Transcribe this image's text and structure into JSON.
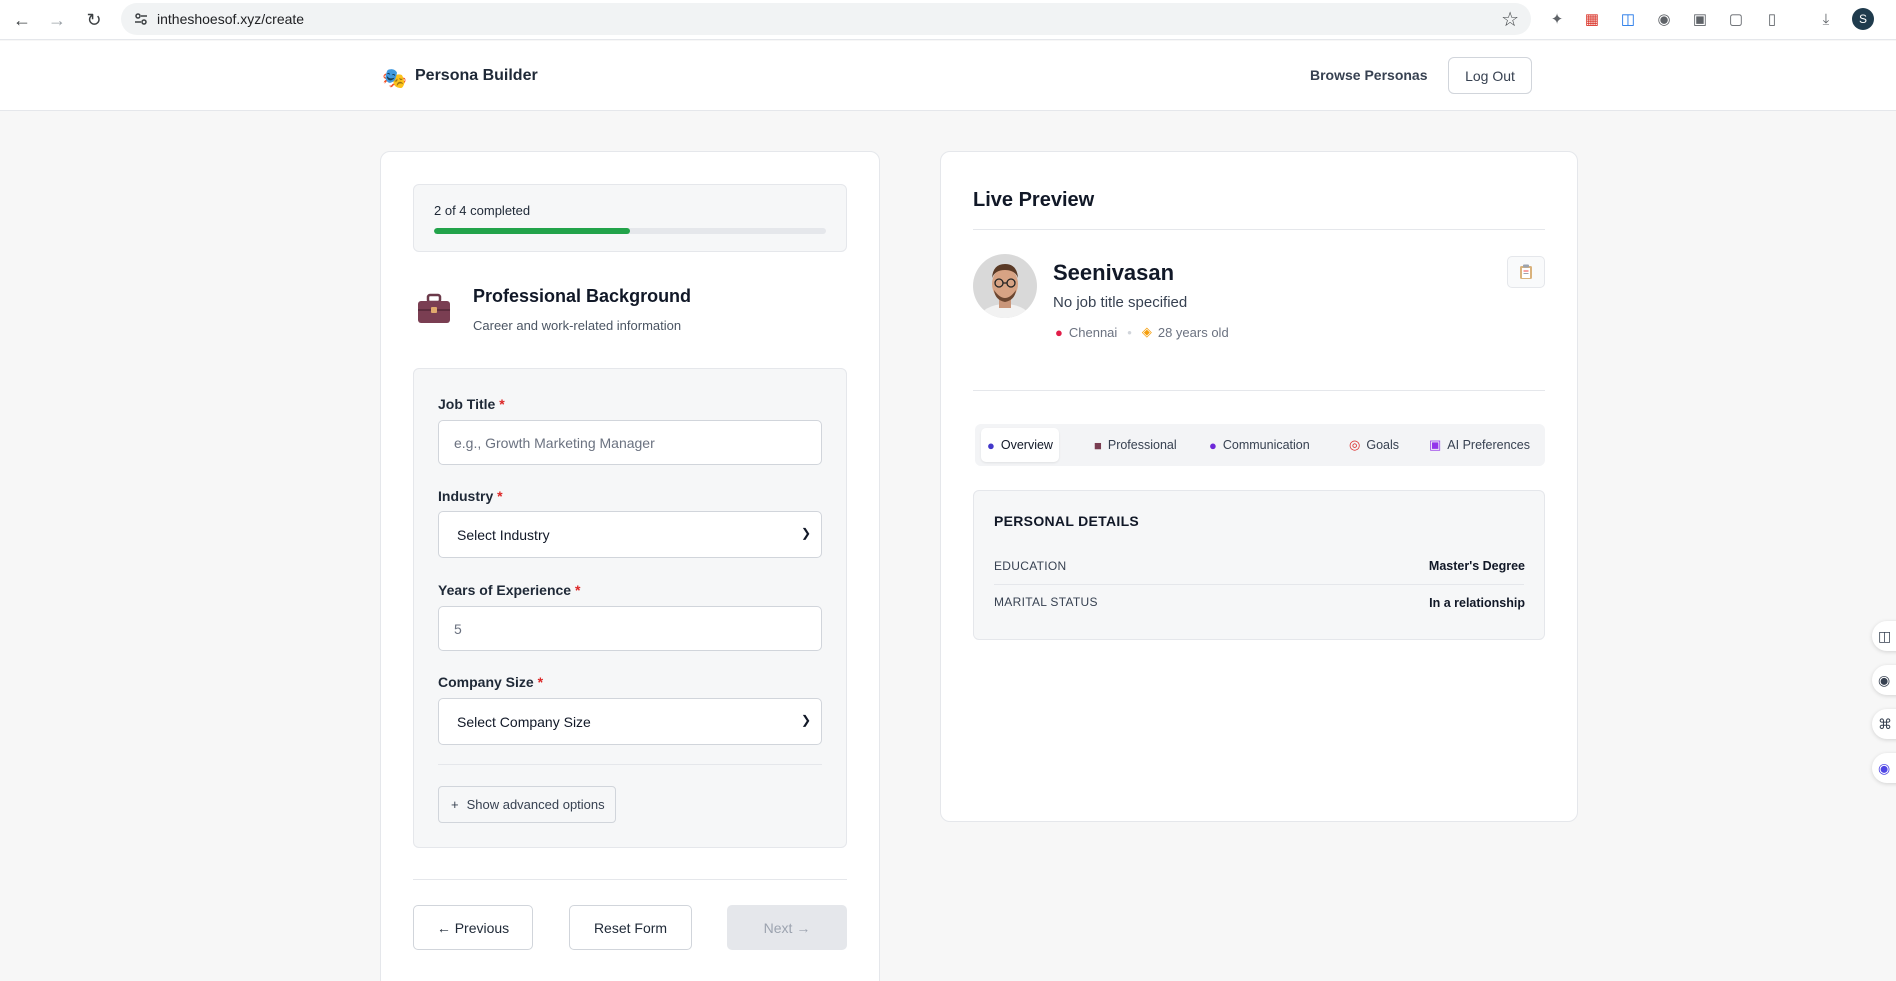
{
  "browser": {
    "url": "intheshoesof.xyz/create",
    "profile_initial": "S"
  },
  "header": {
    "brand": "Persona Builder",
    "logo_icon": "theater-masks-icon",
    "browse_label": "Browse Personas",
    "logout_label": "Log Out"
  },
  "progress": {
    "text": "2 of 4 completed",
    "fraction": 0.5,
    "color": "#22a34a"
  },
  "section": {
    "icon": "briefcase-icon",
    "title": "Professional Background",
    "subtitle": "Career and work-related information"
  },
  "form": {
    "job_title": {
      "label": "Job Title",
      "required": "*",
      "placeholder": "e.g., Growth Marketing Manager"
    },
    "industry": {
      "label": "Industry",
      "required": "*",
      "value": "Select Industry"
    },
    "experience": {
      "label": "Years of Experience",
      "required": "*",
      "value": "5"
    },
    "company_size": {
      "label": "Company Size",
      "required": "*",
      "value": "Select Company Size"
    },
    "advanced_label": "Show advanced options",
    "advanced_plus": "+"
  },
  "actions": {
    "previous": "← Previous",
    "reset": "Reset Form",
    "next": "Next →"
  },
  "preview": {
    "title": "Live Preview",
    "name": "Seenivasan",
    "job": "No job title specified",
    "location": "Chennai",
    "age": "28 years old",
    "tabs": [
      {
        "label": "Overview",
        "icon": "person-icon"
      },
      {
        "label": "Professional",
        "icon": "briefcase-icon"
      },
      {
        "label": "Communication",
        "icon": "speech-head-icon"
      },
      {
        "label": "Goals",
        "icon": "target-icon"
      },
      {
        "label": "AI Preferences",
        "icon": "robot-icon"
      }
    ],
    "details": {
      "title": "PERSONAL DETAILS",
      "rows": [
        {
          "key": "EDUCATION",
          "value": "Master's Degree"
        },
        {
          "key": "MARITAL STATUS",
          "value": "In a relationship"
        }
      ]
    }
  }
}
